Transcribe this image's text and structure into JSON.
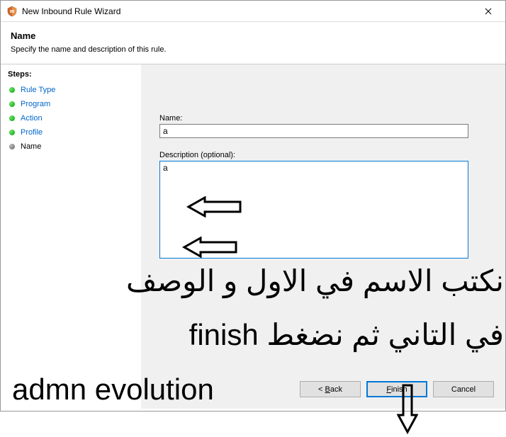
{
  "window": {
    "title": "New Inbound Rule Wizard"
  },
  "header": {
    "title": "Name",
    "subtitle": "Specify the name and description of this rule."
  },
  "sidebar": {
    "heading": "Steps:",
    "steps": [
      {
        "label": "Rule Type"
      },
      {
        "label": "Program"
      },
      {
        "label": "Action"
      },
      {
        "label": "Profile"
      },
      {
        "label": "Name"
      }
    ]
  },
  "form": {
    "name_label": "Name:",
    "name_value": "a",
    "desc_label": "Description (optional):",
    "desc_value": "a"
  },
  "buttons": {
    "back_prefix": "< ",
    "back_accel": "B",
    "back_rest": "ack",
    "finish_accel": "F",
    "finish_rest": "inish",
    "cancel": "Cancel"
  },
  "annotations": {
    "line1": "نكتب الاسم في الاول و الوصف",
    "line2": "في التاني ثم نضغط finish",
    "line3": "admn evolution"
  }
}
